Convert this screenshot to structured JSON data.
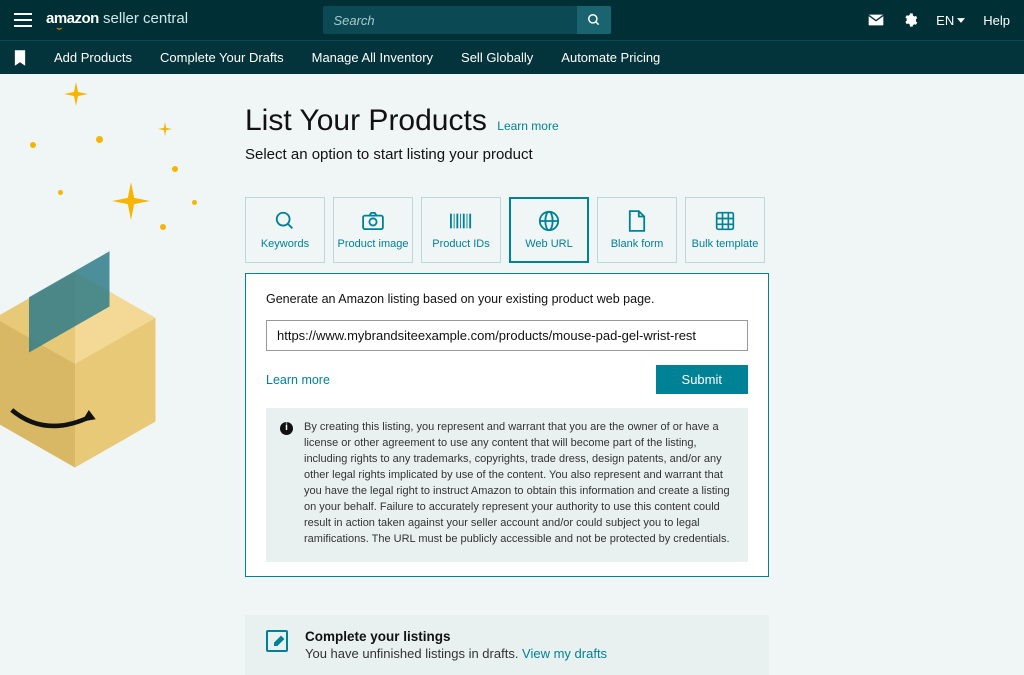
{
  "header": {
    "brand_amazon": "amazon",
    "brand_sc": "seller central",
    "search_placeholder": "Search",
    "lang": "EN",
    "help": "Help"
  },
  "nav": {
    "items": [
      "Add Products",
      "Complete Your Drafts",
      "Manage All Inventory",
      "Sell Globally",
      "Automate Pricing"
    ]
  },
  "page": {
    "title": "List Your Products",
    "learn_more": "Learn more",
    "subtitle": "Select an option to start listing your product"
  },
  "cards": [
    {
      "label": "Keywords"
    },
    {
      "label": "Product image"
    },
    {
      "label": "Product IDs"
    },
    {
      "label": "Web URL"
    },
    {
      "label": "Blank form"
    },
    {
      "label": "Bulk template"
    }
  ],
  "panel": {
    "intro": "Generate an Amazon listing based on your existing product web page.",
    "url_value": "https://www.mybrandsiteexample.com/products/mouse-pad-gel-wrist-rest",
    "learn_more": "Learn more",
    "submit": "Submit",
    "warning": "By creating this listing, you represent and warrant that you are the owner of or have a license or other agreement to use any content that will become part of the listing, including rights to any trademarks, copyrights, trade dress, design patents, and/or any other legal rights implicated by use of the content. You also represent and warrant that you have the legal right to instruct Amazon to obtain this information and create a listing on your behalf. Failure to accurately represent your authority to use this content could result in action taken against your seller account and/or could subject you to legal ramifications. The URL must be publicly accessible and not be protected by credentials."
  },
  "banner": {
    "title": "Complete your listings",
    "sub_prefix": "You have unfinished listings in drafts. ",
    "link": "View my drafts"
  }
}
